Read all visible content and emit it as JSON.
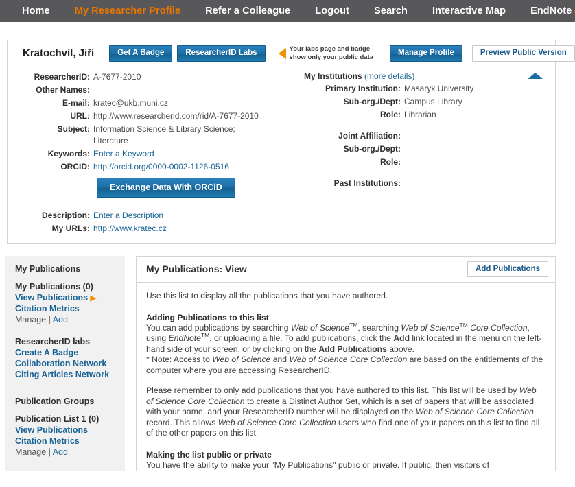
{
  "topnav": {
    "items": [
      {
        "label": "Home",
        "active": false
      },
      {
        "label": "My Researcher Profile",
        "active": true
      },
      {
        "label": "Refer a Colleague",
        "active": false
      },
      {
        "label": "Logout",
        "active": false
      },
      {
        "label": "Search",
        "active": false
      },
      {
        "label": "Interactive Map",
        "active": false
      }
    ],
    "endnote_label": "EndNote",
    "endnote_arrow": "›"
  },
  "profile": {
    "name": "Kratochvíl, Jiří",
    "get_badge_label": "Get A Badge",
    "labs_label": "ResearcherID Labs",
    "callout_line1": "Your labs page and badge",
    "callout_line2": "show only your public data",
    "manage_profile_label": "Manage Profile",
    "preview_public_label": "Preview Public Version",
    "fields": {
      "researcherid_label": "ResearcherID:",
      "researcherid_value": "A-7677-2010",
      "other_names_label": "Other Names:",
      "other_names_value": "",
      "email_label": "E-mail:",
      "email_value": "kratec@ukb.muni.cz",
      "url_label": "URL:",
      "url_value": "http://www.researcherid.com/rid/A-7677-2010",
      "subject_label": "Subject:",
      "subject_value_line1": "Information Science & Library Science;",
      "subject_value_line2": "Literature",
      "keywords_label": "Keywords:",
      "keywords_value": "Enter a Keyword",
      "orcid_label": "ORCID:",
      "orcid_value": "http://orcid.org/0000-0002-1126-0516",
      "orcid_button_label": "Exchange Data With ORCiD",
      "description_label": "Description:",
      "description_value": "Enter a Description",
      "myurls_label": "My URLs:",
      "myurls_value": "http://www.kratec.cz"
    },
    "institutions": {
      "title": "My Institutions",
      "more_details": "(more details)",
      "primary_label": "Primary Institution:",
      "primary_value": "Masaryk University",
      "suborg_label": "Sub-org./Dept:",
      "suborg_value": "Campus Library",
      "role_label": "Role:",
      "role_value": "Librarian",
      "joint_label": "Joint Affiliation:",
      "joint_value": "",
      "joint_suborg_label": "Sub-org./Dept:",
      "joint_suborg_value": "",
      "joint_role_label": "Role:",
      "joint_role_value": "",
      "past_label": "Past Institutions:",
      "past_value": ""
    }
  },
  "sidebar": {
    "header": "My Publications",
    "my_pubs_count_label": "My Publications (0)",
    "view_publications": "View Publications",
    "citation_metrics": "Citation Metrics",
    "manage": "Manage",
    "separator": " | ",
    "add": "Add",
    "labs_header": "ResearcherID labs",
    "create_badge": "Create A Badge",
    "collaboration_network": "Collaboration Network",
    "citing_articles_network": "Citing Articles Network",
    "groups_header": "Publication Groups",
    "list1_label": "Publication List 1 (0)",
    "list1_view": "View Publications",
    "list1_metrics": "Citation Metrics",
    "list1_manage": "Manage",
    "list1_add": "Add"
  },
  "main": {
    "title": "My Publications: View",
    "add_publications_label": "Add Publications",
    "intro": "Use this list to display all the publications that you have authored.",
    "section1_heading": "Adding Publications to this list",
    "section1_p1_a": "You can add publications by searching ",
    "section1_ws1": "Web of Science",
    "section1_tm1": "TM",
    "section1_p1_b": ", searching ",
    "section1_ws2": "Web of Science",
    "section1_tm2": "TM",
    "section1_ws2b": " Core Collection",
    "section1_p1_c": ", using ",
    "section1_endnote": "EndNote",
    "section1_tm3": "TM",
    "section1_p1_d": ", or uploading a file. To add publications, click the ",
    "section1_add_bold": "Add",
    "section1_p1_e": " link located in the menu on the left-hand side of your screen, or by clicking on the ",
    "section1_addpubs_bold": "Add Publications",
    "section1_p1_f": " above.",
    "section1_note_a": "* Note: Access to ",
    "section1_note_ws1": "Web of Science",
    "section1_note_b": " and ",
    "section1_note_ws2": "Web of Science Core Collection",
    "section1_note_c": " are based on the entitlements of the computer where you are accessing ResearcherID.",
    "section2_a": "Please remember to only add publications that you have authored to this list. This list will be used by ",
    "section2_ws1": "Web of Science Core Collection",
    "section2_b": " to create a Distinct Author Set, which is a set of papers that will be associated with your name, and your ResearcherID number will be displayed on the ",
    "section2_ws2": "Web of Science Core Collection",
    "section2_c": " record. This allows ",
    "section2_ws3": "Web of Science Core Collection",
    "section2_d": " users who find one of your papers on this list to find all of the other papers on this list.",
    "section3_heading": "Making the list public or private",
    "section3_p": "You have the ability to make your \"My Publications\" public or private. If public, then visitors of"
  },
  "colors": {
    "nav_bg": "#58585a",
    "accent_orange": "#e77500",
    "link_blue": "#1a6496",
    "button_blue": "#1d6fa8",
    "sidebar_bg": "#f1f1f1"
  }
}
